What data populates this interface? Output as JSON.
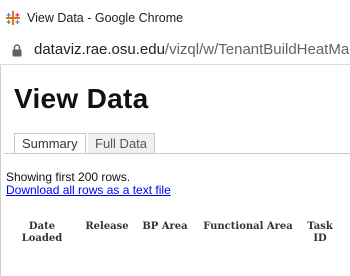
{
  "window": {
    "title": "View Data - Google Chrome",
    "url_host": "dataviz.rae.osu.edu",
    "url_path": "/vizql/w/TenantBuildHeatMap-D"
  },
  "page": {
    "title": "View Data",
    "tabs": [
      {
        "label": "Summary",
        "active": true
      },
      {
        "label": "Full Data",
        "active": false
      }
    ],
    "showing_text": "Showing first 200 rows.",
    "download_link": "Download all rows as a text file"
  },
  "table": {
    "columns": [
      {
        "line1": "Date",
        "line2": "Loaded"
      },
      {
        "line1": "Release",
        "line2": ""
      },
      {
        "line1": "BP Area",
        "line2": ""
      },
      {
        "line1": "Functional Area",
        "line2": ""
      },
      {
        "line1": "Task",
        "line2": "ID"
      }
    ]
  },
  "colors": {
    "link": "#0000ee",
    "inactive_tab_bg": "#f0f0f0",
    "icon_palette": [
      "#e8710a",
      "#4285f4",
      "#34a853",
      "#d93025"
    ]
  }
}
